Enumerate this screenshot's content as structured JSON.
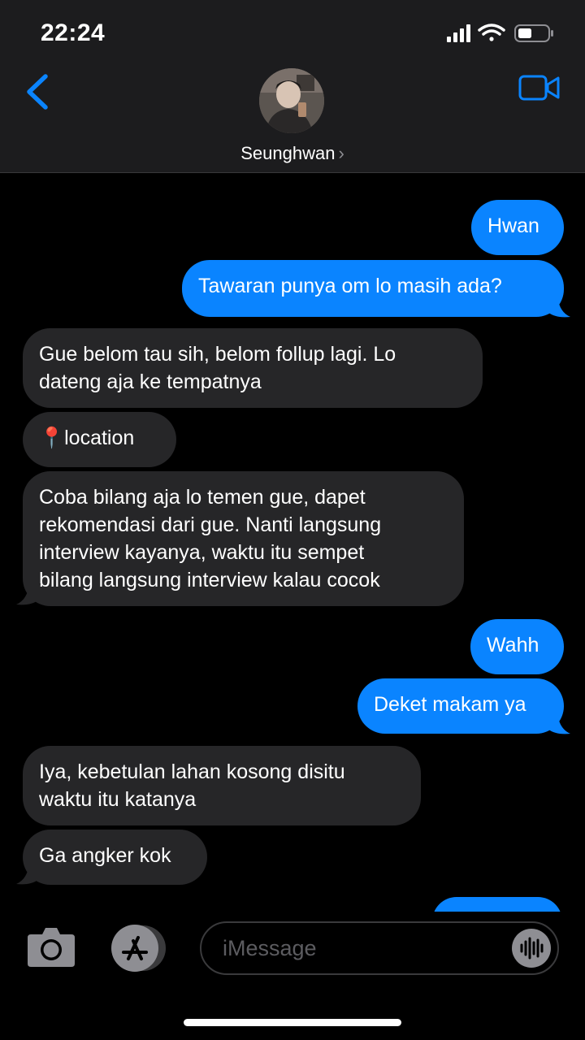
{
  "status_bar": {
    "time": "22:24",
    "icons": [
      "signal-icon",
      "wifi-icon",
      "battery-icon"
    ]
  },
  "header": {
    "contact_name": "Seunghwan",
    "back_icon": "chevron-left-icon",
    "video_icon": "video-camera-icon",
    "avatar": "contact-photo"
  },
  "messages": [
    {
      "direction": "sent",
      "text": "Hwan"
    },
    {
      "direction": "sent",
      "text": "Tawaran punya om lo masih ada?"
    },
    {
      "direction": "received",
      "lines": [
        "Gue belom tau sih, belom follup lagi. Lo",
        "dateng aja ke tempatnya"
      ]
    },
    {
      "direction": "received",
      "text": "📍location"
    },
    {
      "direction": "received",
      "lines": [
        "Coba bilang aja lo temen gue, dapet",
        "rekomendasi dari gue. Nanti langsung",
        "interview kayanya, waktu itu sempet",
        "bilang langsung interview kalau cocok"
      ]
    },
    {
      "direction": "sent",
      "text": "Wahh"
    },
    {
      "direction": "sent",
      "text": "Deket makam ya"
    },
    {
      "direction": "received",
      "lines": [
        "Iya, kebetulan lahan kosong disitu",
        "waktu itu katanya"
      ]
    },
    {
      "direction": "received",
      "text": "Ga angker kok"
    }
  ],
  "input_bar": {
    "placeholder": "iMessage",
    "camera_icon": "camera-icon",
    "appstore_icon": "app-store-icon",
    "audio_icon": "audio-waveform-icon"
  },
  "colors": {
    "sent_bubble": "#0a84ff",
    "received_bubble": "#262628",
    "accent": "#0a84ff",
    "header_bg": "#1c1c1e"
  }
}
